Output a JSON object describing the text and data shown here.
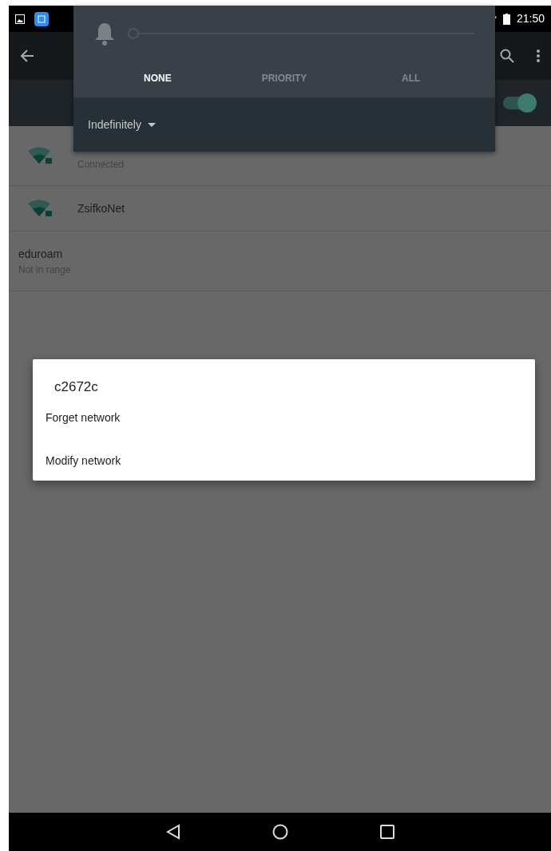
{
  "status_bar": {
    "time": "21:50"
  },
  "wifi_switch": {
    "on": true
  },
  "networks": [
    {
      "kind": "signal",
      "status": "Connected"
    },
    {
      "kind": "signal",
      "name": "ZsifkoNet"
    },
    {
      "kind": "plain",
      "name": "eduroam",
      "status": "Not in range"
    }
  ],
  "notification_panel": {
    "volume": {
      "level": 0
    },
    "modes": [
      {
        "label": "NONE",
        "selected": true
      },
      {
        "label": "PRIORITY",
        "selected": false
      },
      {
        "label": "ALL",
        "selected": false
      }
    ],
    "duration": "Indefinitely"
  },
  "dialog": {
    "title": "c2672c",
    "options": [
      "Forget network",
      "Modify network"
    ]
  }
}
